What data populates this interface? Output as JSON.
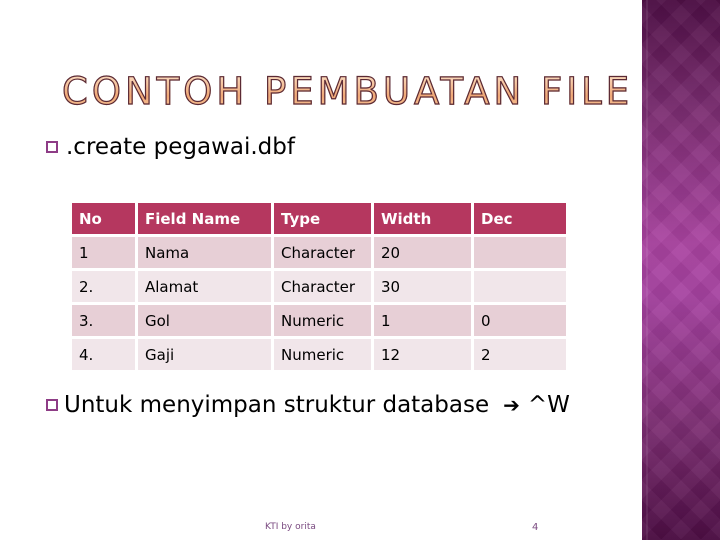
{
  "slide": {
    "title": "CONTOH PEMBUATAN FILE",
    "bullet1": ".create pegawai.dbf",
    "bullet2_text": "Untuk menyimpan struktur database",
    "bullet2_arrow": "➔",
    "bullet2_key": "^W",
    "footer_text": "KTI by orita",
    "page_number": "4"
  },
  "table": {
    "headers": [
      "No",
      "Field Name",
      "Type",
      "Width",
      "Dec"
    ],
    "rows": [
      [
        "1",
        "Nama",
        "Character",
        "20",
        ""
      ],
      [
        "2.",
        "Alamat",
        "Character",
        "30",
        ""
      ],
      [
        "3.",
        "Gol",
        "Numeric",
        "1",
        "0"
      ],
      [
        "4.",
        "Gaji",
        "Numeric",
        "12",
        "2"
      ]
    ]
  },
  "colors": {
    "header_bg": "#b5375f",
    "row_odd_bg": "#e7cfd6",
    "row_even_bg": "#f1e6ea",
    "side_band": "#a943a0",
    "bullet_color": "#8e3c86"
  }
}
